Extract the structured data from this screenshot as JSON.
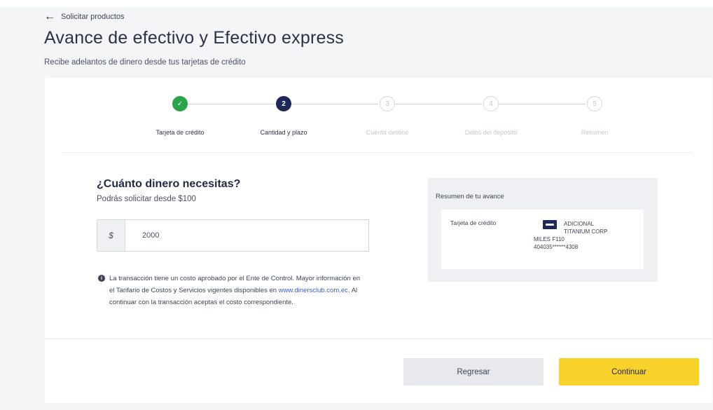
{
  "header": {
    "back_label": "Solicitar productos",
    "title": "Avance de efectivo y Efectivo express",
    "subtitle": "Recibe adelantos de dinero desde tus tarjetas de crédito"
  },
  "stepper": {
    "steps": [
      {
        "number": "✓",
        "label": "Tarjeta de crédito",
        "state": "done"
      },
      {
        "number": "2",
        "label": "Cantidad y plazo",
        "state": "active"
      },
      {
        "number": "3",
        "label": "Cuenta destino",
        "state": "pending"
      },
      {
        "number": "4",
        "label": "Datos del depósito",
        "state": "pending"
      },
      {
        "number": "5",
        "label": "Resumen",
        "state": "pending"
      }
    ]
  },
  "amount": {
    "question": "¿Cuánto dinero necesitas?",
    "hint": "Podrás solicitar desde $100",
    "currency_symbol": "$",
    "value": "2000"
  },
  "note": {
    "text_before_link": "La transacción tiene un costo aprobado por el Ente de Control. Mayor información en el Tarifario de Costos y Servicios vigentes disponibles en ",
    "link_text": "www.dinersclub.com.ec",
    "text_after_link": ". Al continuar con la transacción aceptas el costo correspondiente."
  },
  "summary": {
    "title": "Resumen de tu avance",
    "card_label": "Tarjeta de crédito",
    "card_line1": "ADICIONAL",
    "card_line2": "TITANIUM CORP",
    "card_line3": "MILES F110",
    "card_line4": "404035******4308"
  },
  "footer": {
    "back_button": "Regresar",
    "continue_button": "Continuar"
  },
  "colors": {
    "primary_navy": "#1c2957",
    "success_green": "#2aa44a",
    "accent_yellow": "#f9d12b"
  }
}
